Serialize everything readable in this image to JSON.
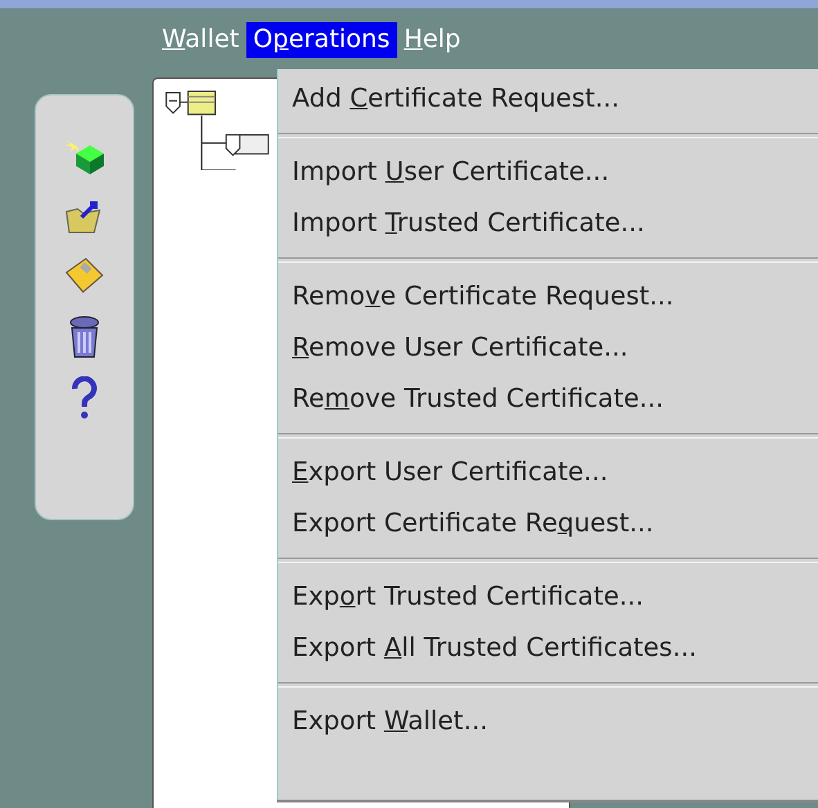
{
  "menu_bar": [
    {
      "mnemonic": "W",
      "label_after": "allet",
      "selected": false
    },
    {
      "label_before": "O",
      "mnemonic": "p",
      "label_after": "erations",
      "selected": true
    },
    {
      "mnemonic": "H",
      "label_after": "elp",
      "selected": false
    }
  ],
  "operations_menu": [
    {
      "kind": "item",
      "label_before": "Add ",
      "mnemonic": "C",
      "label_after": "ertificate Request..."
    },
    {
      "kind": "separator"
    },
    {
      "kind": "item",
      "label_before": "Import ",
      "mnemonic": "U",
      "label_after": "ser Certificate..."
    },
    {
      "kind": "item",
      "label_before": "Import  ",
      "mnemonic": "T",
      "label_after": "rusted Certificate..."
    },
    {
      "kind": "separator"
    },
    {
      "kind": "item",
      "label_before": "Remo",
      "mnemonic": "v",
      "label_after": "e Certificate Request..."
    },
    {
      "kind": "item",
      "mnemonic": "R",
      "label_after": "emove User Certificate..."
    },
    {
      "kind": "item",
      "label_before": "Re",
      "mnemonic": "m",
      "label_after": "ove Trusted Certificate..."
    },
    {
      "kind": "separator"
    },
    {
      "kind": "item",
      "mnemonic": "E",
      "label_after": "xport User Certificate..."
    },
    {
      "kind": "item",
      "label_before": "Export Certificate Re",
      "mnemonic": "q",
      "label_after": "uest..."
    },
    {
      "kind": "separator"
    },
    {
      "kind": "item",
      "label_before": "Exp",
      "mnemonic": "o",
      "label_after": "rt Trusted Certificate..."
    },
    {
      "kind": "item",
      "label_before": "Export ",
      "mnemonic": "A",
      "label_after": "ll Trusted Certificates..."
    },
    {
      "kind": "separator"
    },
    {
      "kind": "item",
      "label_before": "Export ",
      "mnemonic": "W",
      "label_after": "allet..."
    }
  ]
}
